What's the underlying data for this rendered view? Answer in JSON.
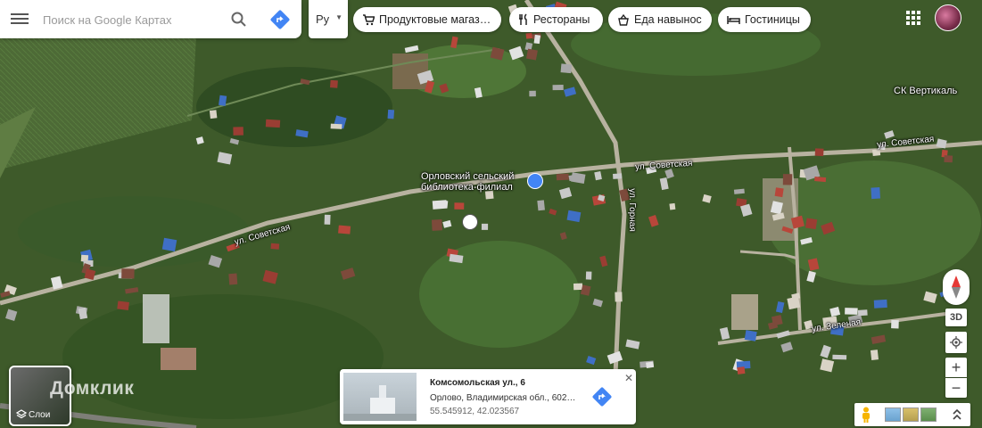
{
  "search": {
    "placeholder": "Поиск на Google Картах",
    "language_value": "Ру"
  },
  "categories": [
    {
      "label": "Продуктовые магаз…",
      "icon": "cart-icon"
    },
    {
      "label": "Рестораны",
      "icon": "fork-knife-icon"
    },
    {
      "label": "Еда навынос",
      "icon": "takeout-icon"
    },
    {
      "label": "Гостиницы",
      "icon": "bed-icon"
    }
  ],
  "map": {
    "labels": {
      "library": "Орловский сельский\nбиблиотека-филиал",
      "sport_club": "СК Вертикаль",
      "street_sovetskaya_1": "ул. Советская",
      "street_sovetskaya_2": "ул. Советская",
      "street_sovetskaya_3": "ул. Советская",
      "street_gornaya": "ул. Горная",
      "street_zelenaya": "ул. Зеленая"
    }
  },
  "layers": {
    "label": "Слои"
  },
  "watermark": "Домклик",
  "info_card": {
    "title": "Комсомольская ул., 6",
    "address": "Орлово, Владимирская обл., 602…",
    "coords": "55.545912, 42.023567"
  },
  "controls": {
    "three_d": "3D",
    "zoom_in": "+",
    "zoom_out": "−"
  },
  "colors": {
    "accent": "#4285f4",
    "directions_bg": "#4285f4"
  }
}
